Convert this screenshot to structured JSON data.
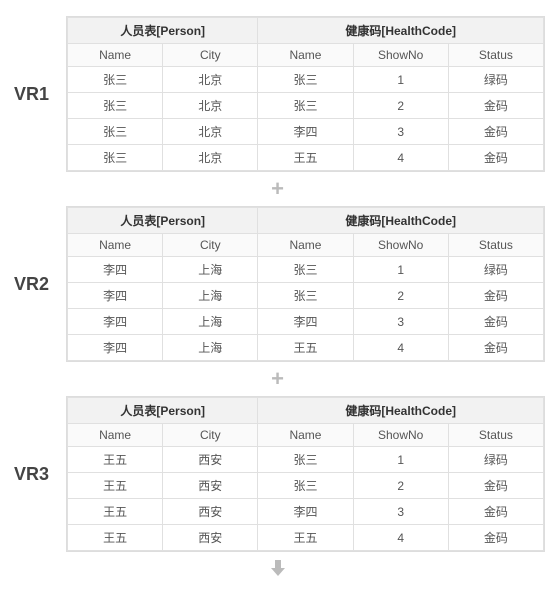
{
  "headers": {
    "person_group": "人员表[Person]",
    "health_group": "健康码[HealthCode]",
    "person_name": "Name",
    "person_city": "City",
    "health_name": "Name",
    "health_showno": "ShowNo",
    "health_status": "Status"
  },
  "vr1": {
    "label": "VR1",
    "rows": [
      {
        "pn": "张三",
        "pc": "北京",
        "hn": "张三",
        "sn": "1",
        "st": "绿码"
      },
      {
        "pn": "张三",
        "pc": "北京",
        "hn": "张三",
        "sn": "2",
        "st": "金码"
      },
      {
        "pn": "张三",
        "pc": "北京",
        "hn": "李四",
        "sn": "3",
        "st": "金码"
      },
      {
        "pn": "张三",
        "pc": "北京",
        "hn": "王五",
        "sn": "4",
        "st": "金码"
      }
    ]
  },
  "vr2": {
    "label": "VR2",
    "rows": [
      {
        "pn": "李四",
        "pc": "上海",
        "hn": "张三",
        "sn": "1",
        "st": "绿码"
      },
      {
        "pn": "李四",
        "pc": "上海",
        "hn": "张三",
        "sn": "2",
        "st": "金码"
      },
      {
        "pn": "李四",
        "pc": "上海",
        "hn": "李四",
        "sn": "3",
        "st": "金码"
      },
      {
        "pn": "李四",
        "pc": "上海",
        "hn": "王五",
        "sn": "4",
        "st": "金码"
      }
    ]
  },
  "vr3": {
    "label": "VR3",
    "rows": [
      {
        "pn": "王五",
        "pc": "西安",
        "hn": "张三",
        "sn": "1",
        "st": "绿码"
      },
      {
        "pn": "王五",
        "pc": "西安",
        "hn": "张三",
        "sn": "2",
        "st": "金码"
      },
      {
        "pn": "王五",
        "pc": "西安",
        "hn": "李四",
        "sn": "3",
        "st": "金码"
      },
      {
        "pn": "王五",
        "pc": "西安",
        "hn": "王五",
        "sn": "4",
        "st": "金码"
      }
    ]
  },
  "separators": {
    "plus": "+",
    "arrow": "down-arrow-icon"
  }
}
